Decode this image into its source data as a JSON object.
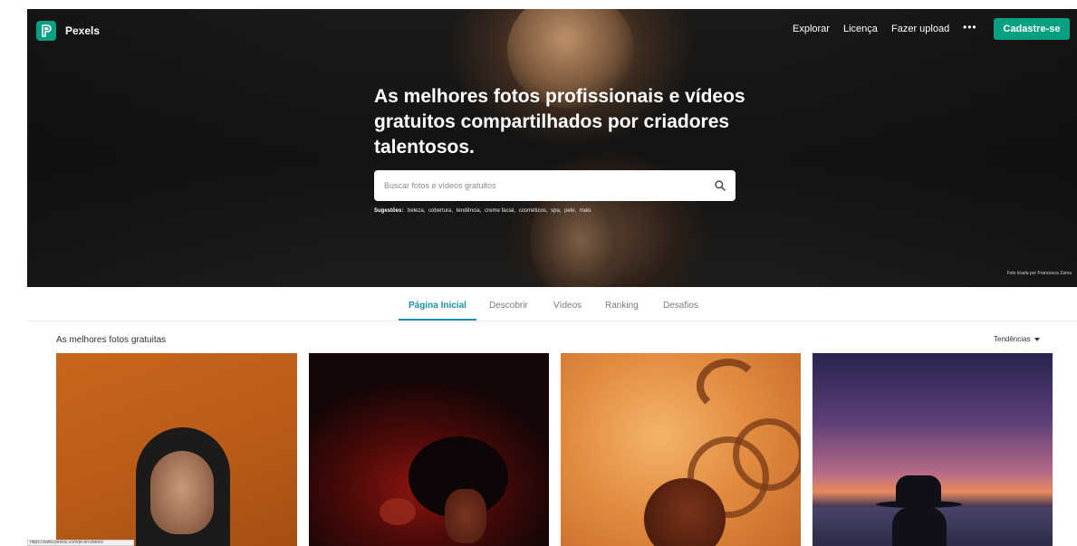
{
  "brand": {
    "name": "Pexels",
    "accent": "#05a081"
  },
  "topnav": {
    "explore": "Explorar",
    "license": "Licença",
    "upload": "Fazer upload",
    "more": "•••",
    "signup": "Cadastre-se"
  },
  "hero": {
    "title": "As melhores fotos profissionais e vídeos gratuitos compartilhados por criadores talentosos.",
    "search_placeholder": "Buscar fotos e vídeos gratuitos",
    "suggestions_label": "Sugestões:",
    "suggestions": [
      "beleza,",
      "cobertura,",
      "tendência,",
      "creme facial,",
      "cosméticos,",
      "spa,",
      "pele,",
      "mais"
    ],
    "credit": "Foto tirada por Francesca Zama"
  },
  "tabs": {
    "home": "Página Inicial",
    "discover": "Descobrir",
    "videos": "Vídeos",
    "ranking": "Ranking",
    "challenges": "Desafios",
    "active_color": "#1a8fa8"
  },
  "gallery": {
    "title": "As melhores fotos gratuitas",
    "sort": "Tendências"
  },
  "status": {
    "url": "https://www.pexels.com/pt-br/videos/"
  }
}
